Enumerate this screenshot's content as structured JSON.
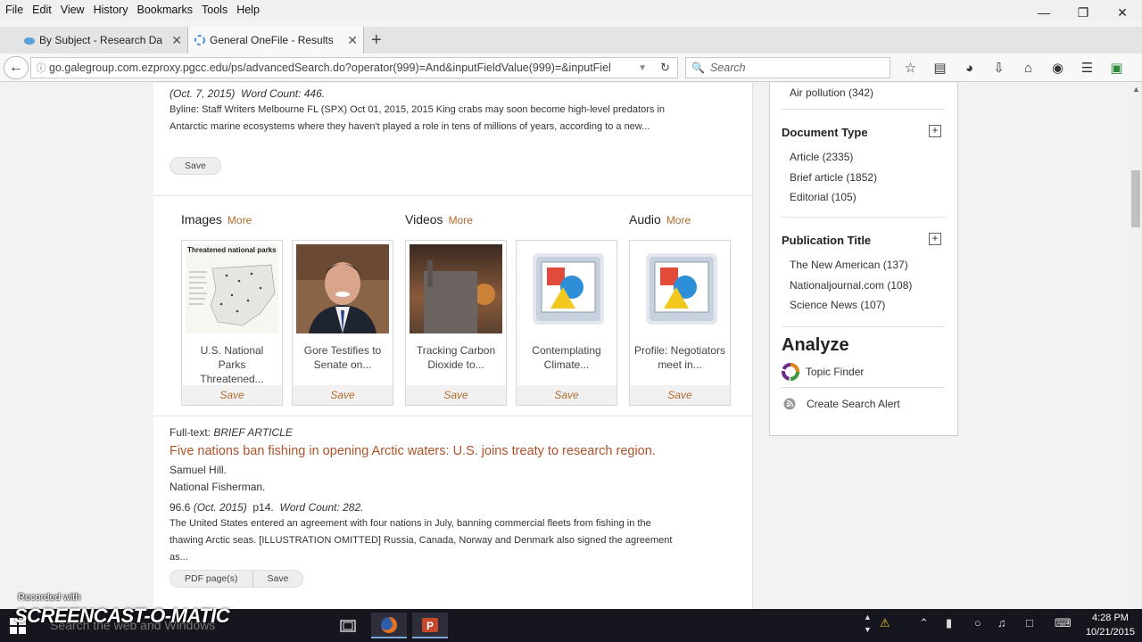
{
  "menu": [
    "File",
    "Edit",
    "View",
    "History",
    "Bookmarks",
    "Tools",
    "Help"
  ],
  "tabs": [
    {
      "title": "By Subject - Research Dat...",
      "active": false
    },
    {
      "title": "General OneFile - Results -...",
      "active": true
    }
  ],
  "nav": {
    "url": "go.galegroup.com.ezproxy.pgcc.edu/ps/advancedSearch.do?operator(999)=And&inputFieldValue(999)=&inputFiel",
    "search_placeholder": "Search"
  },
  "result1": {
    "meta_date": "(Oct. 7, 2015)",
    "meta_count": "Word Count: 446.",
    "snippet": "Byline: Staff Writers Melbourne FL (SPX) Oct 01, 2015, 2015 King crabs may soon become high-level predators in Antarctic marine ecosystems where they haven't played a role in tens of millions of years, according to a new...",
    "save": "Save"
  },
  "media": {
    "images_label": "Images",
    "videos_label": "Videos",
    "audio_label": "Audio",
    "more": "More",
    "save": "Save",
    "items": [
      {
        "caption": "U.S. National Parks Threatened...",
        "thumb_title": "Threatened national parks"
      },
      {
        "caption": "Gore Testifies to Senate on..."
      },
      {
        "caption": "Tracking Carbon Dioxide to..."
      },
      {
        "caption": "Contemplating Climate..."
      },
      {
        "caption": "Profile: Negotiators meet in..."
      }
    ]
  },
  "result2": {
    "type_label": "Full-text:",
    "type": "BRIEF ARTICLE",
    "title": "Five nations ban fishing in opening Arctic waters: U.S. joins treaty to research region.",
    "author": "Samuel Hill.",
    "publication": "National Fisherman.",
    "volume": "96.6",
    "date": "(Oct. 2015)",
    "page": "p14.",
    "word_count": "Word Count: 282.",
    "snippet": "The United States entered an agreement with four nations in July, banning commercial fleets from fishing in the thawing Arctic seas. [ILLUSTRATION OMITTED] Russia, Canada, Norway and Denmark also signed the agreement as...",
    "pdf": "PDF page(s)",
    "save": "Save"
  },
  "sidebar": {
    "top_item": "Air pollution (342)",
    "doc_type_head": "Document Type",
    "doc_types": [
      "Article (2335)",
      "Brief article (1852)",
      "Editorial (105)"
    ],
    "pub_title_head": "Publication Title",
    "pub_titles": [
      "The New American (137)",
      "Nationaljournal.com (108)",
      "Science News (107)"
    ],
    "analyze": "Analyze",
    "topic_finder": "Topic Finder",
    "create_alert": "Create Search Alert"
  },
  "taskbar": {
    "search": "Search the web and Windows",
    "time": "4:28 PM",
    "date": "10/21/2015"
  },
  "watermark": {
    "small": "Recorded with",
    "big": "SCREENCAST-O-MATIC"
  },
  "colors": {
    "link": "#b0522a",
    "more": "#b26b2c"
  }
}
